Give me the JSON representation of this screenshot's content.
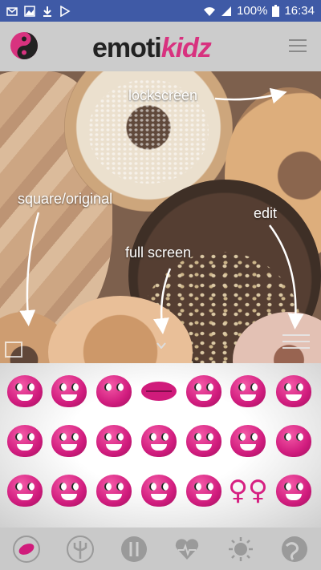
{
  "status_bar": {
    "battery": "100%",
    "time": "16:34",
    "left_icons": [
      "mail-icon",
      "image-icon",
      "download-icon",
      "play-store-icon"
    ],
    "right_icons": [
      "wifi-icon",
      "signal-icon",
      "battery-icon"
    ]
  },
  "header": {
    "brand_part1": "emoti",
    "brand_part2": "kidz",
    "left_icon": "yin-yang-icon",
    "right_icon": "menu-icon"
  },
  "annotations": {
    "lockscreen": "lockscreen",
    "square_original": "square/original",
    "edit": "edit",
    "full_screen": "full screen"
  },
  "emoji_grid": {
    "rows": [
      [
        "laughing-emoji",
        "grin-emoji",
        "kiss-hearts-emoji",
        "lips-icon",
        "thumbs-up-emoji",
        "cake-emoji",
        "laugh-tears-emoji"
      ],
      [
        "big-smile-emoji",
        "squint-laugh-emoji",
        "thumbs-up-emoji",
        "thumbs-up-emoji",
        "heart-eyes-emoji",
        "heart-eyes-emoji",
        "kiss-emoji"
      ],
      [
        "tongue-out-emoji",
        "money-emoji",
        "thumbs-up-emoji",
        "wink-emoji",
        "angel-emoji",
        "female-symbols-icon",
        "smirk-emoji"
      ]
    ]
  },
  "bottom_nav": [
    "lips-nav-icon",
    "trident-nav-icon",
    "cutlery-nav-icon",
    "heartbeat-nav-icon",
    "sun-nav-icon",
    "globe-nav-icon"
  ],
  "colors": {
    "status_bar": "#3f5aa6",
    "brand_pink": "#d8327f",
    "emoji_pink": "#d11c7e"
  }
}
